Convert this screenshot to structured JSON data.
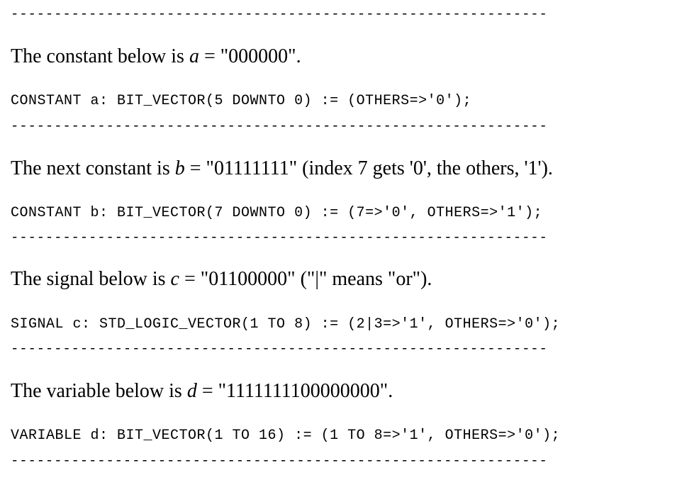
{
  "separator": "--------------------------------------------------------------",
  "blocks": [
    {
      "text_before": "The constant below is ",
      "var": "a",
      "text_after": " = \"000000\".",
      "code": "CONSTANT a: BIT_VECTOR(5 DOWNTO 0) := (OTHERS=>'0');"
    },
    {
      "text_before": "The next constant is ",
      "var": "b",
      "text_after": " = \"01111111\" (index 7 gets '0', the others, '1').",
      "code": "CONSTANT b: BIT_VECTOR(7 DOWNTO 0) := (7=>'0', OTHERS=>'1');"
    },
    {
      "text_before": "The signal below is ",
      "var": "c",
      "text_after": " = \"01100000\" (\"|\" means \"or\").",
      "code": "SIGNAL c: STD_LOGIC_VECTOR(1 TO 8) := (2|3=>'1', OTHERS=>'0');"
    },
    {
      "text_before": "The variable below is ",
      "var": "d",
      "text_after": " = \"1111111100000000\".",
      "code": "VARIABLE d: BIT_VECTOR(1 TO 16) := (1 TO 8=>'1', OTHERS=>'0');"
    }
  ]
}
